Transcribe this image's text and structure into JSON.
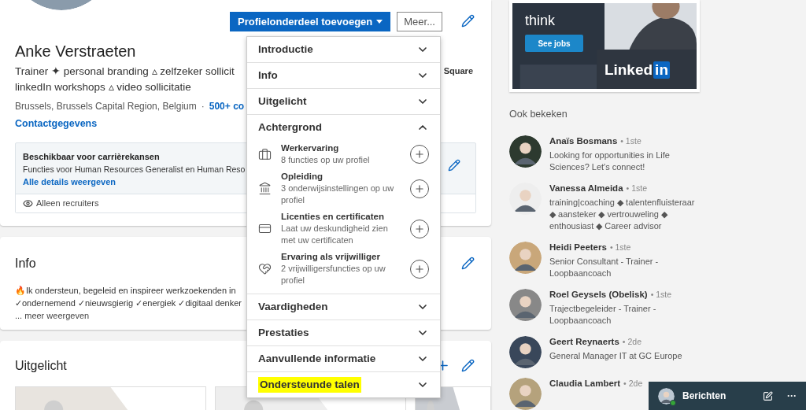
{
  "profile": {
    "name": "Anke Verstraeten",
    "headline": [
      "Trainer ✦ personal branding ▵ zelfzeker sollicit",
      "linkedIn workshops ▵ video sollicitatie"
    ],
    "company": "Square",
    "location": "Brussels, Brussels Capital Region, Belgium",
    "separator": "·",
    "connections": "500+ co",
    "contact": "Contactgegevens",
    "add_button": "Profielonderdeel toevoegen",
    "more_button": "Meer...",
    "availability": {
      "title": "Beschikbaar voor carrièrekansen",
      "text": "Functies voor Human Resources Generalist en Human Reso",
      "link": "Alle details weergeven",
      "visibility": "Alleen recruiters"
    }
  },
  "info": {
    "title": "Info",
    "lines": [
      "🔥Ik ondersteun, begeleid en inspireer werkzoekenden in",
      "✓ondernemend ✓nieuwsgierig ✓energiek ✓digitaal denker"
    ],
    "more": "... meer weergeven"
  },
  "featured": {
    "title": "Uitgelicht"
  },
  "dropdown": {
    "sections": [
      {
        "label": "Introductie",
        "expanded": false,
        "highlighted": false
      },
      {
        "label": "Info",
        "expanded": false,
        "highlighted": false
      },
      {
        "label": "Uitgelicht",
        "expanded": false,
        "highlighted": false
      },
      {
        "label": "Achtergrond",
        "expanded": true,
        "highlighted": false,
        "items": [
          {
            "title": "Werkervaring",
            "text": "8 functies op uw profiel"
          },
          {
            "title": "Opleiding",
            "text": "3 onderwijsinstellingen op uw profiel"
          },
          {
            "title": "Licenties en certificaten",
            "text": "Laat uw deskundigheid zien met uw certificaten"
          },
          {
            "title": "Ervaring als vrijwilliger",
            "text": "2 vrijwilligersfuncties op uw profiel"
          }
        ]
      },
      {
        "label": "Vaardigheden",
        "expanded": false,
        "highlighted": false
      },
      {
        "label": "Prestaties",
        "expanded": false,
        "highlighted": false
      },
      {
        "label": "Aanvullende informatie",
        "expanded": false,
        "highlighted": false
      },
      {
        "label": "Ondersteunde talen",
        "expanded": false,
        "highlighted": true
      }
    ]
  },
  "ad": {
    "headline": [
      "think"
    ],
    "button": "See jobs",
    "logo": [
      "Linked",
      "in"
    ]
  },
  "also_viewed": {
    "title": "Ook bekeken",
    "people": [
      {
        "name": "Anaïs Bosmans",
        "degree": "• 1ste",
        "headline": "Looking for opportunities in Life Sciences? Let's connect!"
      },
      {
        "name": "Vanessa Almeida",
        "degree": "• 1ste",
        "headline": "training|coaching ◆ talentenfluisteraar ◆ aansteker ◆ vertrouweling ◆ enthousiast ◆ Career advisor"
      },
      {
        "name": "Heidi Peeters",
        "degree": "• 1ste",
        "headline": "Senior Consultant - Trainer - Loopbaancoach"
      },
      {
        "name": "Roel Geysels (Obelisk)",
        "degree": "• 1ste",
        "headline": "Trajectbegeleider - Trainer - Loopbaancoach"
      },
      {
        "name": "Geert Reynaerts",
        "degree": "• 2de",
        "headline": "General Manager IT at GC Europe"
      },
      {
        "name": "Claudia Lambert",
        "degree": "• 2de"
      }
    ]
  },
  "messaging": {
    "title": "Berichten",
    "more": "···",
    "online": true
  }
}
